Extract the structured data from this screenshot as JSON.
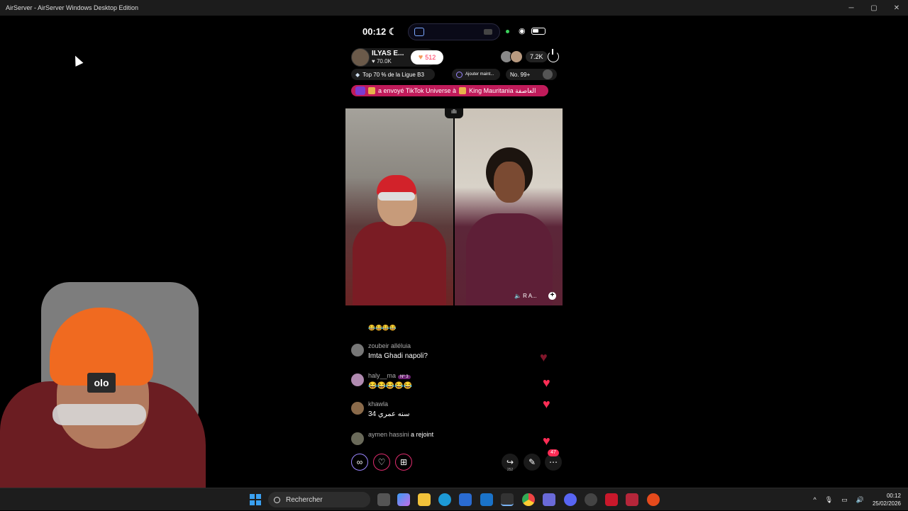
{
  "window": {
    "title": "AirServer - AirServer Windows Desktop Edition",
    "min": "─",
    "max": "▢",
    "close": "✕"
  },
  "phone_status": {
    "time": "00:12",
    "moon": "☾",
    "wifi": "◉"
  },
  "streamer": {
    "name": "ILYAS E...",
    "likes": "♥ 70.0K",
    "follow_count": "512"
  },
  "viewers": {
    "count": "7.2K"
  },
  "league": {
    "text": "Top 70 % de la Ligue B3"
  },
  "add": {
    "text": "Ajouter maint..."
  },
  "rank": {
    "text": "No. 99+"
  },
  "gift_banner": {
    "text": "a envoyé TikTok Universe à",
    "target": "King Mauritania العاصفة"
  },
  "video": {
    "top_tag": "ıllı",
    "right_label": "🔈 R A...",
    "plus": "+"
  },
  "comments": {
    "emojis_row": "😂😂😂😂",
    "items": [
      {
        "user": "zoubeir alléluia",
        "text": "Imta Ghadi napoli?"
      },
      {
        "user": "haly__ma",
        "badges": "Nº 3",
        "text": "😂😂😂😂😂"
      },
      {
        "user": "khawla",
        "text": "34 سنه عمري"
      },
      {
        "user": "aymen hassini",
        "text": "a rejoint"
      }
    ]
  },
  "actions": {
    "share_count": "252",
    "more_count": "47"
  },
  "cam_logo": "olo",
  "taskbar": {
    "search_placeholder": "Rechercher",
    "time": "00:12",
    "date": "25/02/2026",
    "tray_caret": "^"
  },
  "colors": {
    "accent": "#fe2c55",
    "gift_banner": "#c01b5a",
    "windows_blue": "#3aa0f0"
  }
}
